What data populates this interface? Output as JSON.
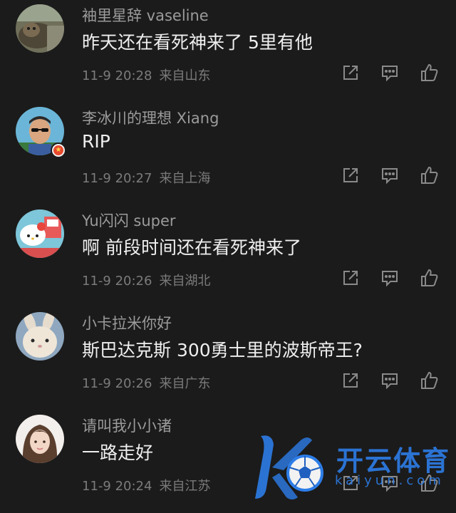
{
  "comments": [
    {
      "username": "袖里星辞 vaseline",
      "text": "昨天还在看死神来了 5里有他",
      "time": "11-9 20:28",
      "location": "来自山东",
      "avatar_icon": "cat-photo-avatar",
      "verified": false
    },
    {
      "username": "李冰川的理想 Xiang",
      "text": "RIP",
      "time": "11-9 20:27",
      "location": "来自上海",
      "avatar_icon": "man-sunglasses-avatar",
      "verified": true,
      "badge_icon": "star-badge-icon"
    },
    {
      "username": "Yu闪闪 super",
      "text": "啊 前段时间还在看死神来了",
      "time": "11-9 20:26",
      "location": "来自湖北",
      "avatar_icon": "hello-kitty-avatar",
      "verified": false
    },
    {
      "username": "小卡拉米你好",
      "text": "斯巴达克斯 300勇士里的波斯帝王?",
      "time": "11-9 20:26",
      "location": "来自广东",
      "avatar_icon": "rabbit-avatar",
      "verified": false
    },
    {
      "username": "请叫我小小诸",
      "text": "一路走好",
      "time": "11-9 20:24",
      "location": "来自江苏",
      "avatar_icon": "girl-avatar",
      "verified": false
    }
  ],
  "actions": {
    "share_icon": "share-icon",
    "reply_icon": "reply-icon",
    "like_icon": "like-icon"
  },
  "watermark": {
    "text_cn": "开云体育",
    "text_en": "kaiyun.com"
  },
  "colors": {
    "background": "#1b1b1b",
    "username": "#9b9b9b",
    "text": "#efefef",
    "meta": "#7b7b7b",
    "watermark": "#2d7de8"
  }
}
